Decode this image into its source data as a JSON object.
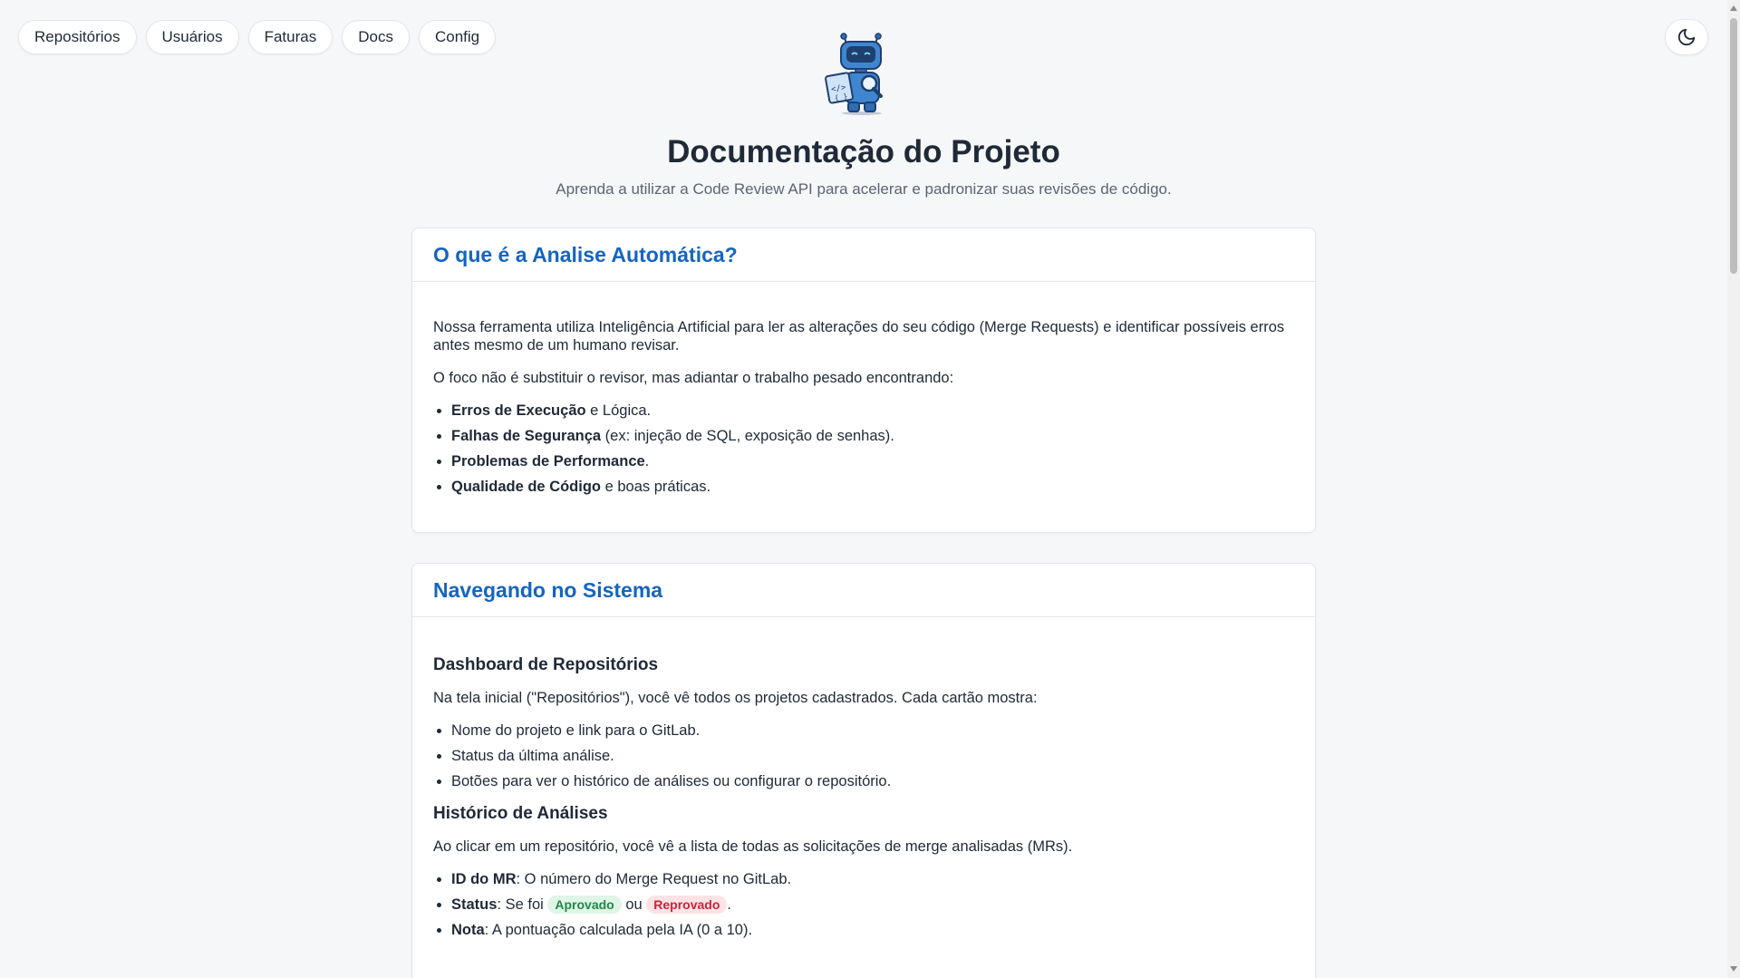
{
  "nav": {
    "items": [
      {
        "label": "Repositórios",
        "name": "nav-repositorios"
      },
      {
        "label": "Usuários",
        "name": "nav-usuarios"
      },
      {
        "label": "Faturas",
        "name": "nav-faturas"
      },
      {
        "label": "Docs",
        "name": "nav-docs"
      },
      {
        "label": "Config",
        "name": "nav-config"
      }
    ]
  },
  "theme_toggle_icon": "moon-icon",
  "header": {
    "logo_icon": "robot-logo-icon",
    "title": "Documentação do Projeto",
    "subtitle": "Aprenda a utilizar a Code Review API para acelerar e padronizar suas revisões de código."
  },
  "card1": {
    "title": "O que é a Analise Automática?",
    "p1": "Nossa ferramenta utiliza Inteligência Artificial para ler as alterações do seu código (Merge Requests) e identificar possíveis erros antes mesmo de um humano revisar.",
    "p2": "O foco não é substituir o revisor, mas adiantar o trabalho pesado encontrando:",
    "items": [
      {
        "bold": "Erros de Execução",
        "rest": " e Lógica."
      },
      {
        "bold": "Falhas de Segurança",
        "rest": " (ex: injeção de SQL, exposição de senhas)."
      },
      {
        "bold": "Problemas de Performance",
        "rest": "."
      },
      {
        "bold": "Qualidade de Código",
        "rest": " e boas práticas."
      }
    ]
  },
  "card2": {
    "title": "Navegando no Sistema",
    "section1": {
      "heading": "Dashboard de Repositórios",
      "intro": "Na tela inicial (\"Repositórios\"), você vê todos os projetos cadastrados. Cada cartão mostra:",
      "items": [
        "Nome do projeto e link para o GitLab.",
        "Status da última análise.",
        "Botões para ver o histórico de análises ou configurar o repositório."
      ]
    },
    "section2": {
      "heading": "Histórico de Análises",
      "intro": "Ao clicar em um repositório, você vê a lista de todas as solicitações de merge analisadas (MRs).",
      "item1": {
        "bold": "ID do MR",
        "rest": ": O número do Merge Request no GitLab."
      },
      "item2": {
        "bold": "Status",
        "pre": ": Se foi ",
        "approved": "Aprovado",
        "middle": " ou ",
        "rejected": "Reprovado",
        "post": "."
      },
      "item3": {
        "bold": "Nota",
        "rest": ": A pontuação calculada pela IA (0 a 10)."
      }
    }
  }
}
